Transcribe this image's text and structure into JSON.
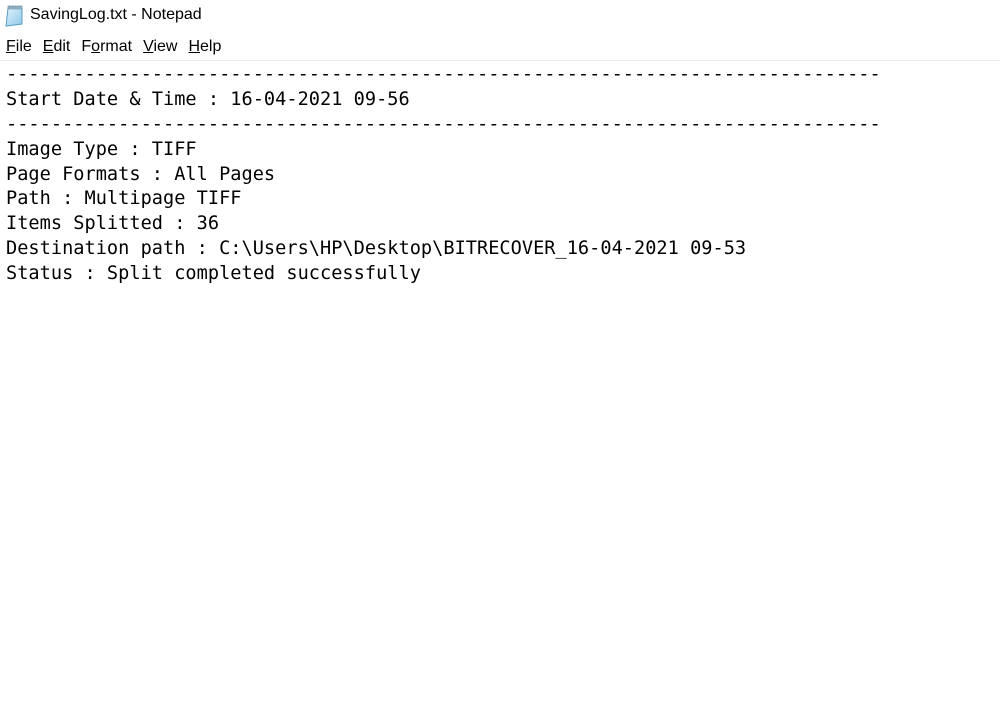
{
  "window": {
    "title": "SavingLog.txt - Notepad",
    "app_icon": "notepad-icon"
  },
  "menubar": {
    "items": [
      {
        "label": "File",
        "mnemonic": "F",
        "pre": "",
        "key": "F",
        "post": "ile"
      },
      {
        "label": "Edit",
        "mnemonic": "E",
        "pre": "",
        "key": "E",
        "post": "dit"
      },
      {
        "label": "Format",
        "mnemonic": "o",
        "pre": "F",
        "key": "o",
        "post": "rmat"
      },
      {
        "label": "View",
        "mnemonic": "V",
        "pre": "",
        "key": "V",
        "post": "iew"
      },
      {
        "label": "Help",
        "mnemonic": "H",
        "pre": "",
        "key": "H",
        "post": "elp"
      }
    ]
  },
  "document": {
    "lines": [
      "------------------------------------------------------------------------------",
      "Start Date & Time : 16-04-2021 09-56",
      "------------------------------------------------------------------------------",
      "Image Type : TIFF",
      "Page Formats : All Pages",
      "Path : Multipage TIFF",
      "Items Splitted : 36",
      "Destination path : C:\\Users\\HP\\Desktop\\BITRECOVER_16-04-2021 09-53",
      "Status : Split completed successfully"
    ]
  }
}
